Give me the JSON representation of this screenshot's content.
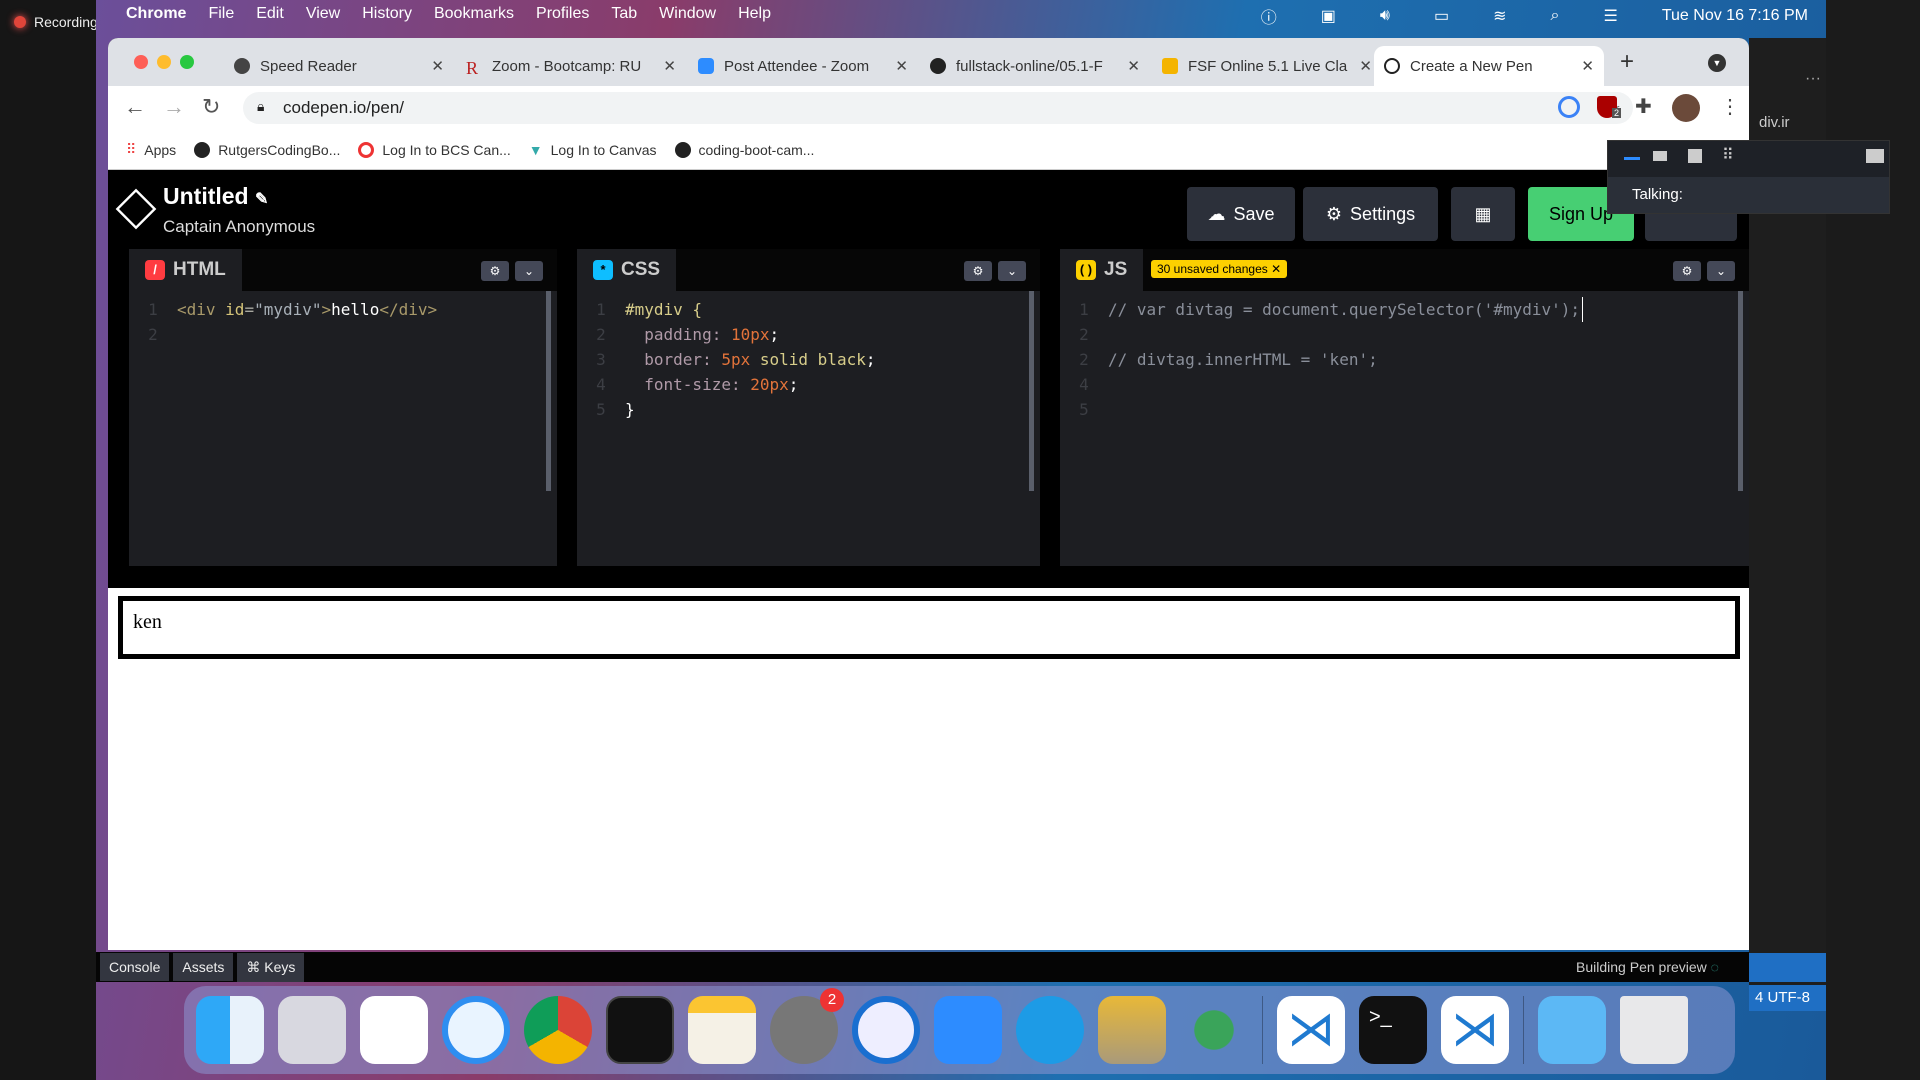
{
  "recording": "Recording",
  "menubar": {
    "app": "Chrome",
    "items": [
      "File",
      "Edit",
      "View",
      "History",
      "Bookmarks",
      "Profiles",
      "Tab",
      "Window",
      "Help"
    ],
    "clock": "Tue Nov 16  7:16 PM"
  },
  "tabs": [
    {
      "title": "Speed Reader",
      "color": "#444"
    },
    {
      "title": "Zoom - Bootcamp: RU",
      "color": "#b22"
    },
    {
      "title": "Post Attendee - Zoom",
      "color": "#2d8cff"
    },
    {
      "title": "fullstack-online/05.1-F",
      "color": "#222"
    },
    {
      "title": "FSF Online 5.1 Live Cla",
      "color": "#f4b400"
    },
    {
      "title": "Create a New Pen",
      "color": "#222",
      "active": true
    }
  ],
  "url": "codepen.io/pen/",
  "extension_badge": "2",
  "bookmarks": [
    "Apps",
    "RutgersCodingBo...",
    "Log In to BCS Can...",
    "Log In to Canvas",
    "coding-boot-cam..."
  ],
  "codepen": {
    "title": "Untitled",
    "user": "Captain Anonymous",
    "save": "Save",
    "settings": "Settings",
    "signup": "Sign Up"
  },
  "panes": {
    "html": {
      "label": "HTML",
      "color": "#ff3c41",
      "lines": [
        "<div id=\"mydiv\">hello</div>",
        ""
      ]
    },
    "css": {
      "label": "CSS",
      "color": "#0ebeff",
      "lines": [
        "#mydiv {",
        "  padding: 10px;",
        "  border: 5px solid black;",
        "  font-size: 20px;",
        "}"
      ]
    },
    "js": {
      "label": "JS",
      "color": "#fcd000",
      "badge": "30 unsaved changes",
      "lines": [
        "// var divtag = document.querySelector('#mydiv');",
        "",
        "// divtag.innerHTML = 'ken';",
        "",
        ""
      ],
      "line_numbers": [
        "1",
        "2",
        "2",
        "4",
        "5"
      ]
    }
  },
  "preview_text": "ken",
  "bottombar": {
    "console": "Console",
    "assets": "Assets",
    "keys": "⌘ Keys",
    "status": "Building Pen preview"
  },
  "zoom_popup": {
    "talking": "Talking:"
  },
  "vscode": {
    "breadcrumb": "div.ir",
    "status": "4   UTF-8"
  },
  "dock": {
    "badge": "2"
  }
}
